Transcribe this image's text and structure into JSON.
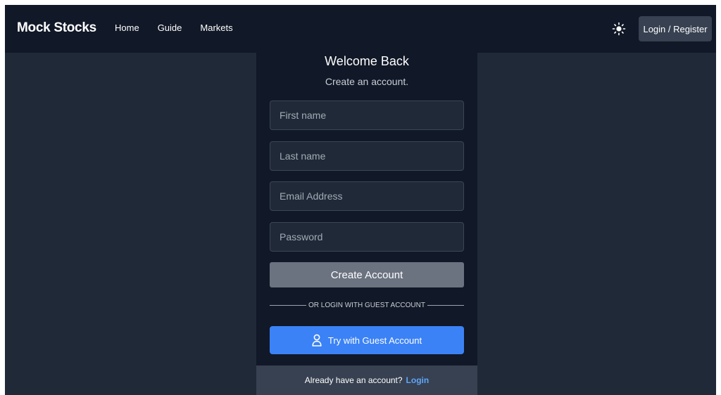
{
  "navbar": {
    "brand": "Mock Stocks",
    "links": [
      "Home",
      "Guide",
      "Markets"
    ],
    "theme_icon": "sun-icon",
    "login_register": "Login / Register"
  },
  "form": {
    "title": "Welcome Back",
    "subtitle": "Create an account.",
    "first_name_placeholder": "First name",
    "last_name_placeholder": "Last name",
    "email_placeholder": "Email Address",
    "password_placeholder": "Password",
    "create_account": "Create Account",
    "divider_text": "OR LOGIN WITH GUEST ACCOUNT",
    "guest_button": "Try with Guest Account",
    "guest_icon": "user-icon",
    "footer_text": "Already have an account?",
    "footer_link": "Login"
  },
  "colors": {
    "background": "#1f2937",
    "navbar": "#111827",
    "card": "#111827",
    "accent": "#3b82f6",
    "link": "#60a5fa",
    "create_button": "#6b7280"
  }
}
